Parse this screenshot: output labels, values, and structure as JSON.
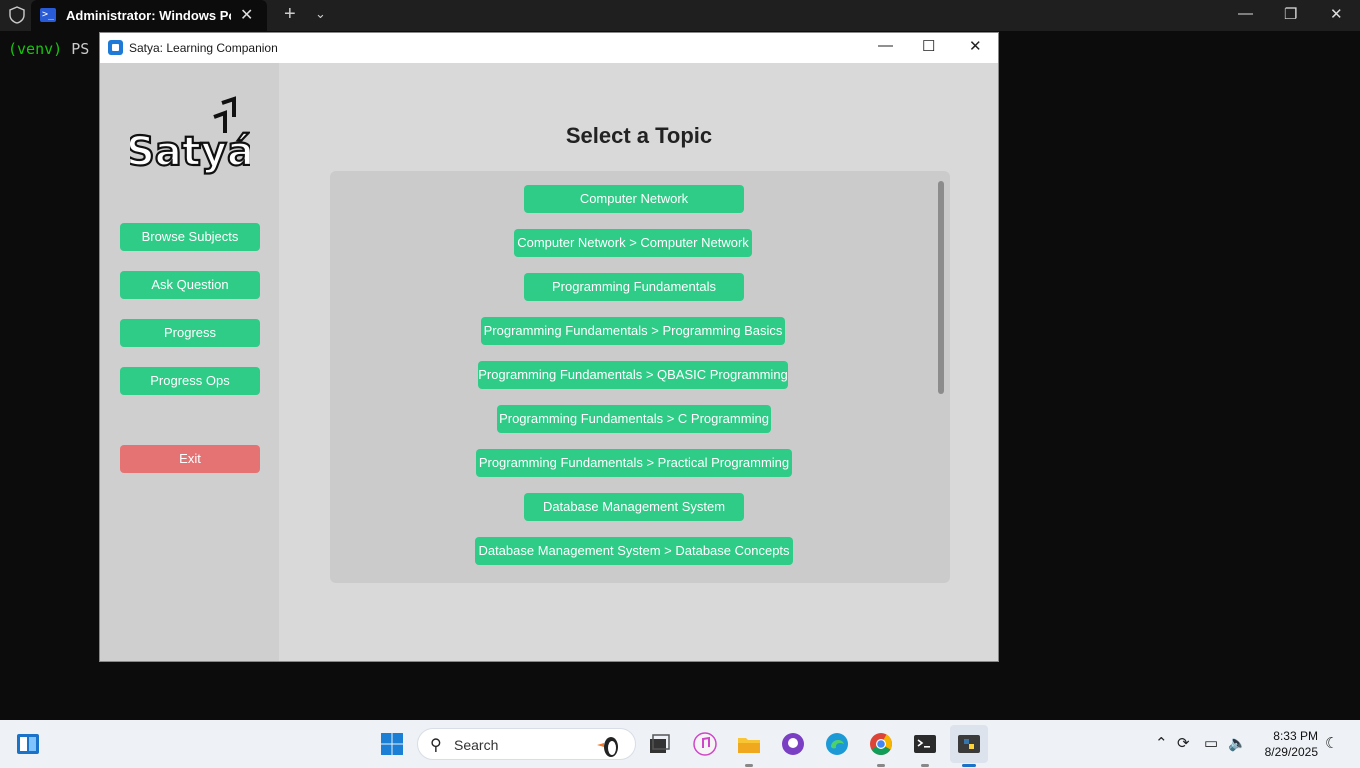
{
  "terminal": {
    "tab_title": "Administrator: Windows Powe",
    "tab_close": "✕",
    "new_tab": "+",
    "dropdown": "⌄",
    "minimize": "—",
    "maximize": "❐",
    "close": "✕",
    "prompt_venv": "(venv)",
    "prompt_ps": " PS",
    "tab_icon": ">_"
  },
  "app": {
    "title": "Satya: Learning Companion",
    "minimize": "—",
    "maximize": "☐",
    "close": "✕",
    "logo_text": "Satyá",
    "sidebar": {
      "buttons": [
        {
          "label": "Browse Subjects"
        },
        {
          "label": "Ask Question"
        },
        {
          "label": "Progress"
        },
        {
          "label": "Progress Ops"
        }
      ],
      "exit_label": "Exit"
    },
    "main": {
      "heading": "Select a Topic",
      "topics": [
        {
          "label": "Computer Network"
        },
        {
          "label": "Computer Network > Computer Network"
        },
        {
          "label": "Programming Fundamentals"
        },
        {
          "label": "Programming Fundamentals > Programming Basics"
        },
        {
          "label": "Programming Fundamentals > QBASIC Programming"
        },
        {
          "label": "Programming Fundamentals > C Programming"
        },
        {
          "label": "Programming Fundamentals > Practical Programming"
        },
        {
          "label": "Database Management System"
        },
        {
          "label": "Database Management System > Database Concepts"
        }
      ]
    }
  },
  "taskbar": {
    "search_placeholder": "Search",
    "time": "8:33 PM",
    "date": "8/29/2025",
    "icons": [
      "start-icon",
      "search-icon",
      "task-view-icon",
      "itunes-icon",
      "file-explorer-icon",
      "github-desktop-icon",
      "edge-icon",
      "chrome-icon",
      "terminal-icon",
      "python-icon"
    ],
    "tray": [
      "chevron-up-icon",
      "sync-icon",
      "network-icon",
      "volume-icon",
      "moon-icon"
    ]
  },
  "colors": {
    "button_green": "#2ecc87",
    "exit_red": "#e57373",
    "sidebar_bg": "#cfcfcf",
    "main_bg": "#d9d9d9",
    "panel_bg": "#cbcbcb"
  }
}
